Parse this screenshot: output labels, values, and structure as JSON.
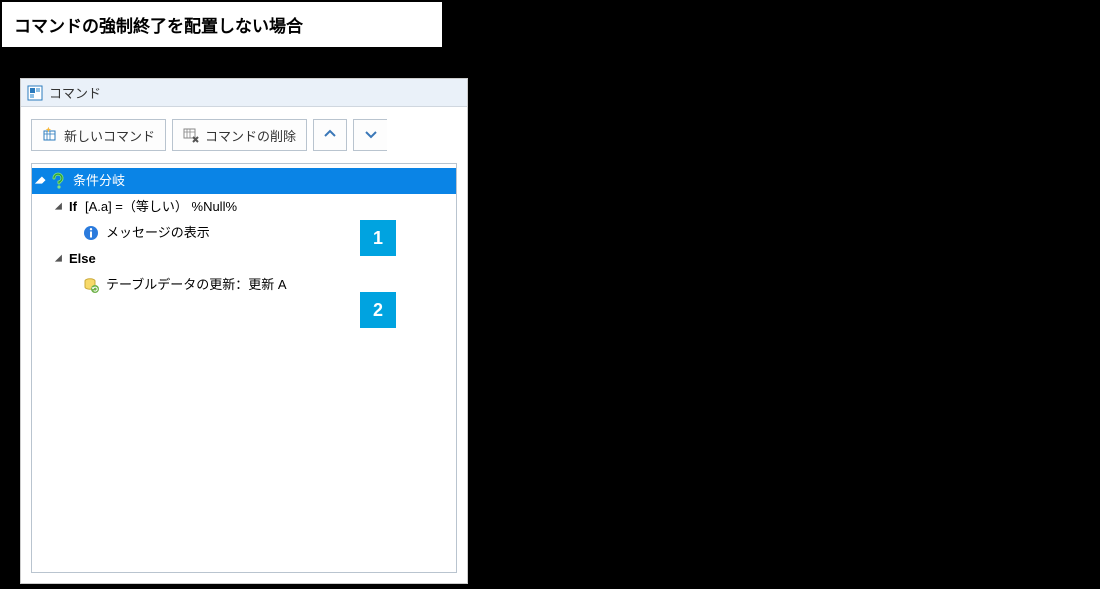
{
  "caption": "コマンドの強制終了を配置しない場合",
  "panel": {
    "title": "コマンド"
  },
  "toolbar": {
    "new_label": "新しいコマンド",
    "delete_label": "コマンドの削除"
  },
  "tree": {
    "root": {
      "label": "条件分岐"
    },
    "if_keyword": "If",
    "if_expr": "[A.a] =（等しい） %Null%",
    "if_child": "メッセージの表示",
    "else_keyword": "Else",
    "else_child": "テーブルデータの更新：更新 A"
  },
  "callouts": {
    "one": "1",
    "two": "2"
  }
}
